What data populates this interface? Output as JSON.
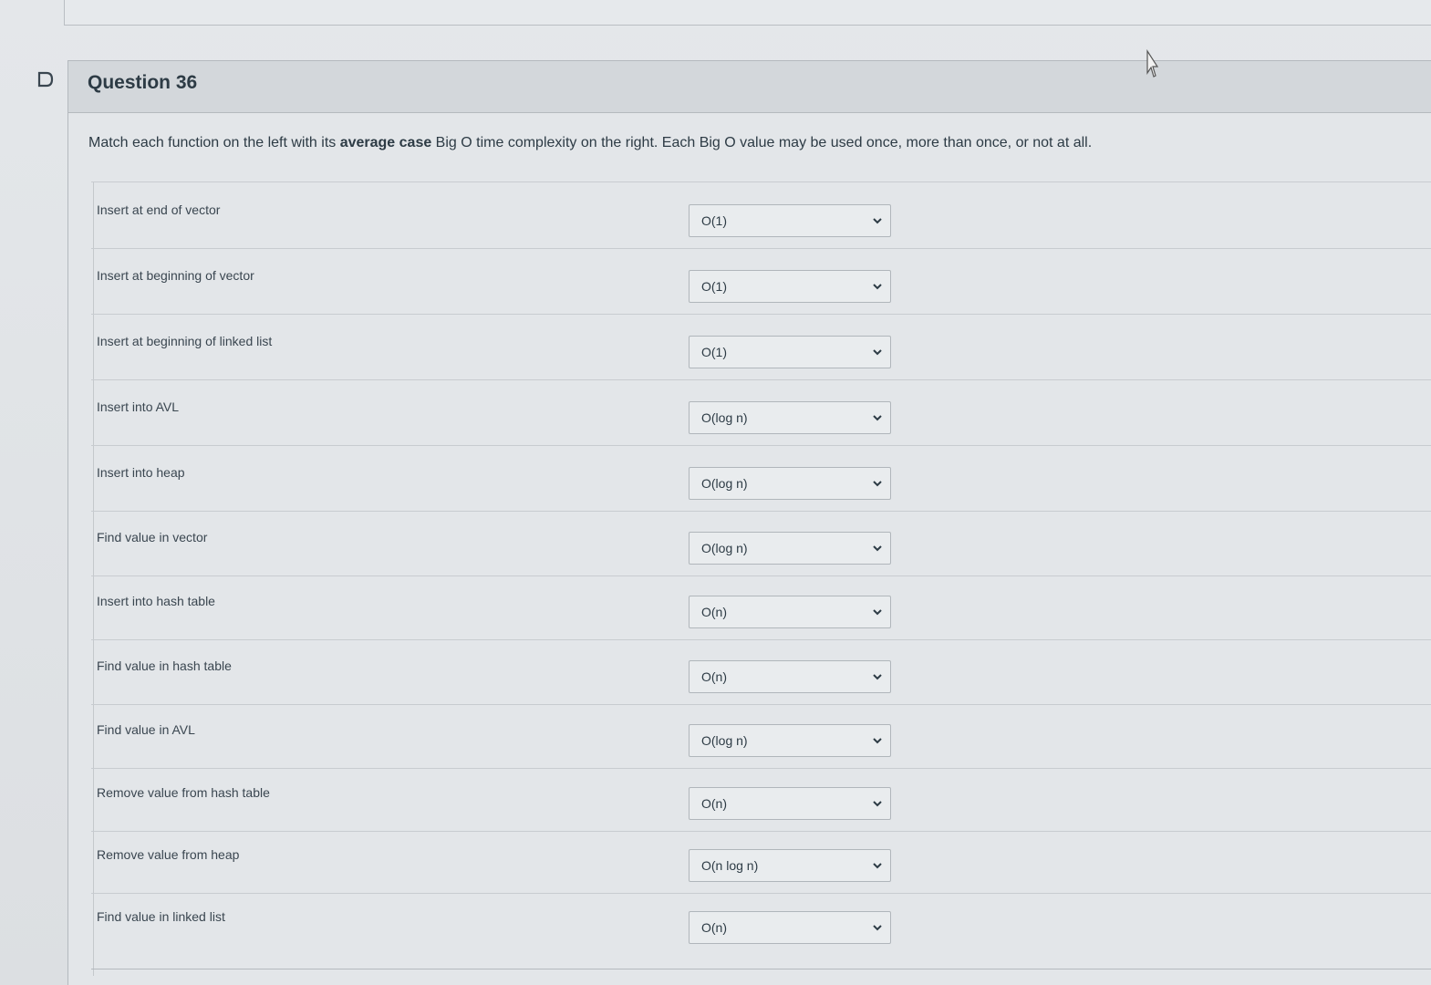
{
  "question": {
    "title": "Question 36",
    "instructions_pre": "Match each function on the left with its ",
    "instructions_bold": "average case",
    "instructions_post": " Big O time complexity on the right. Each Big O value may be used once, more than once, or not at all."
  },
  "icons": {
    "flag": "flag-icon",
    "cursor": "mouse-cursor-icon",
    "chevron": "chevron-down-icon"
  },
  "colors": {
    "header_bg": "#d3d7db",
    "text": "#2d3b45",
    "border": "#b4b9be"
  },
  "rows": [
    {
      "label": "Insert at end of vector",
      "selected": "O(1)"
    },
    {
      "label": "Insert at beginning of vector",
      "selected": "O(1)"
    },
    {
      "label": "Insert at beginning of linked list",
      "selected": "O(1)"
    },
    {
      "label": "Insert into AVL",
      "selected": "O(log n)"
    },
    {
      "label": "Insert into heap",
      "selected": "O(log n)"
    },
    {
      "label": "Find value in vector",
      "selected": "O(log n)"
    },
    {
      "label": "Insert into hash table",
      "selected": "O(n)"
    },
    {
      "label": "Find value in hash table",
      "selected": "O(n)"
    },
    {
      "label": "Find value in AVL",
      "selected": "O(log n)"
    },
    {
      "label": "Remove value from hash table",
      "selected": "O(n)"
    },
    {
      "label": "Remove value from heap",
      "selected": "O(n log n)"
    },
    {
      "label": "Find value in linked list",
      "selected": "O(n)"
    }
  ]
}
